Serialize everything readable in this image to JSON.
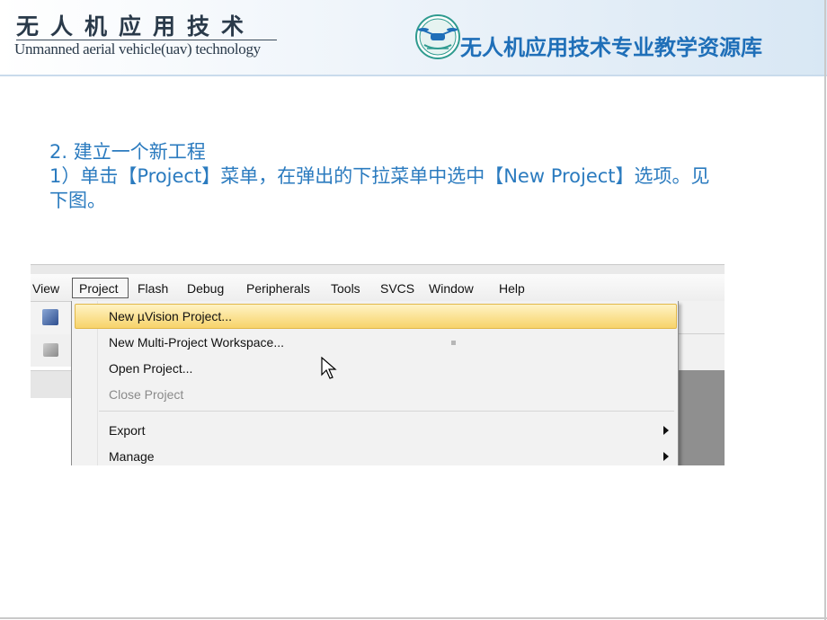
{
  "header": {
    "brand_cn": "无人机应用技术",
    "brand_en": "Unmanned aerial vehicle(uav) technology",
    "library_title": "无人机应用技术专业教学资源库"
  },
  "content": {
    "step_heading": "2. 建立一个新工程",
    "instruction_line1": "1）单击【Project】菜单，在弹出的下拉菜单中选中【New Project】选项。见",
    "instruction_line2": "下图。"
  },
  "screenshot": {
    "menubar": [
      "View",
      "Project",
      "Flash",
      "Debug",
      "Peripherals",
      "Tools",
      "SVCS",
      "Window",
      "Help"
    ],
    "active_menu": "Project",
    "dropdown_items": [
      {
        "label": "New µVision Project...",
        "state": "highlighted"
      },
      {
        "label": "New Multi-Project Workspace...",
        "state": "normal"
      },
      {
        "label": "Open Project...",
        "state": "normal"
      },
      {
        "label": "Close Project",
        "state": "disabled"
      },
      {
        "label": "Export",
        "state": "submenu"
      },
      {
        "label": "Manage",
        "state": "submenu"
      }
    ]
  },
  "colors": {
    "body_text": "#2b7bbf",
    "library_title": "#1f6fb8",
    "highlight": "#f7d36a"
  }
}
